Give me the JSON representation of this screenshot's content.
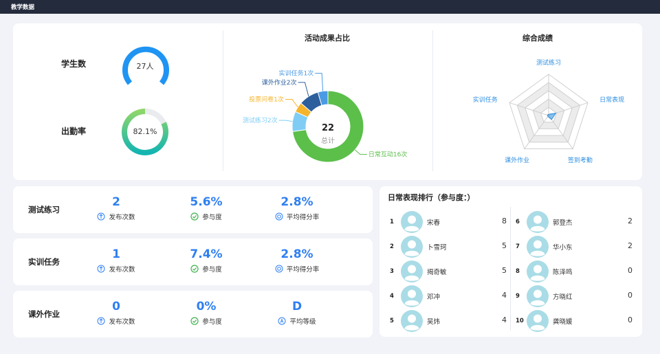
{
  "app": {
    "title": "教学数据"
  },
  "overview": {
    "students_label": "学生数",
    "students_value": "27人",
    "attendance_label": "出勤率",
    "attendance_value": "82.1%",
    "attendance_fraction": 0.821
  },
  "activity": {
    "title": "活动成果占比",
    "total_value": "22",
    "total_label": "总计",
    "colors": [
      "#5bbf4a",
      "#7fcdf5",
      "#f6b42b",
      "#2c5f9c",
      "#4a9ae4"
    ],
    "chart_data": {
      "type": "pie",
      "labels": [
        "日常互动16次",
        "测试练习2次",
        "投票问卷1次",
        "课外作业2次",
        "实训任务1次"
      ],
      "values": [
        16,
        2,
        1,
        2,
        1
      ]
    }
  },
  "radar": {
    "title": "综合成绩",
    "chart_data": {
      "type": "radar",
      "axes": [
        "测试练习",
        "日常表现",
        "签到考勤",
        "课外作业",
        "实训任务"
      ],
      "values": [
        0.03,
        0.18,
        0.12,
        0.03,
        0.03
      ],
      "max": 1
    }
  },
  "metrics": [
    {
      "name": "测试练习",
      "items": [
        {
          "value": "2",
          "caption": "发布次数",
          "icon": "upload-icon"
        },
        {
          "value": "5.6%",
          "caption": "参与度",
          "icon": "check-circle-icon"
        },
        {
          "value": "2.8%",
          "caption": "平均得分率",
          "icon": "score-icon"
        }
      ]
    },
    {
      "name": "实训任务",
      "items": [
        {
          "value": "1",
          "caption": "发布次数",
          "icon": "upload-icon"
        },
        {
          "value": "7.4%",
          "caption": "参与度",
          "icon": "check-circle-icon"
        },
        {
          "value": "2.8%",
          "caption": "平均得分率",
          "icon": "score-icon"
        }
      ]
    },
    {
      "name": "课外作业",
      "items": [
        {
          "value": "0",
          "caption": "发布次数",
          "icon": "upload-icon"
        },
        {
          "value": "0%",
          "caption": "参与度",
          "icon": "check-circle-icon"
        },
        {
          "value": "D",
          "caption": "平均等级",
          "icon": "grade-icon"
        }
      ]
    }
  ],
  "ranking": {
    "title": "日常表现排行（参与度：）",
    "items": [
      {
        "rank": "1",
        "name": "宋春",
        "score": "8"
      },
      {
        "rank": "2",
        "name": "卜雪珂",
        "score": "5"
      },
      {
        "rank": "3",
        "name": "揭奇敏",
        "score": "5"
      },
      {
        "rank": "4",
        "name": "邓冲",
        "score": "4"
      },
      {
        "rank": "5",
        "name": "吴炜",
        "score": "4"
      },
      {
        "rank": "6",
        "name": "郭登杰",
        "score": "2"
      },
      {
        "rank": "7",
        "name": "华小东",
        "score": "2"
      },
      {
        "rank": "8",
        "name": "陈泽鸣",
        "score": "0"
      },
      {
        "rank": "9",
        "name": "方晓红",
        "score": "0"
      },
      {
        "rank": "10",
        "name": "龚晓媛",
        "score": "0"
      }
    ]
  }
}
